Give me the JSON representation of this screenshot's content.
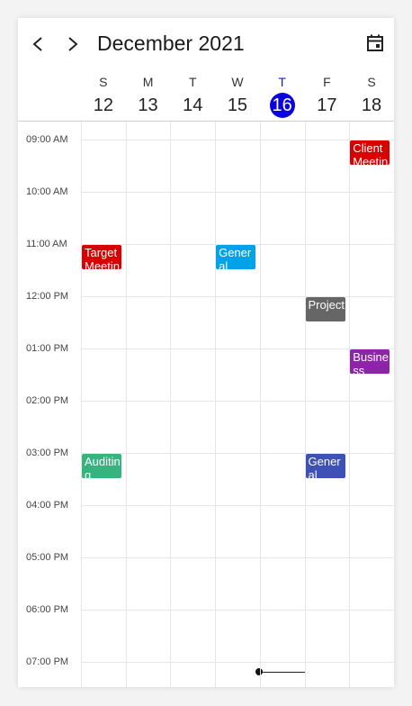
{
  "header": {
    "title": "December 2021",
    "prev_icon": "chevron-left-icon",
    "next_icon": "chevron-right-icon",
    "today_icon": "calendar-icon"
  },
  "days": [
    {
      "label": "S",
      "date": "12"
    },
    {
      "label": "M",
      "date": "13"
    },
    {
      "label": "T",
      "date": "14"
    },
    {
      "label": "W",
      "date": "15"
    },
    {
      "label": "T",
      "date": "16"
    },
    {
      "label": "F",
      "date": "17"
    },
    {
      "label": "S",
      "date": "18"
    }
  ],
  "today_index": 4,
  "today_color": "#0b00e0",
  "times": [
    "09:00 AM",
    "10:00 AM",
    "11:00 AM",
    "12:00 PM",
    "01:00 PM",
    "02:00 PM",
    "03:00 PM",
    "04:00 PM",
    "05:00 PM",
    "06:00 PM",
    "07:00 PM"
  ],
  "appointments": [
    {
      "title": "Client Meeting",
      "day": 6,
      "start": "09:00 AM",
      "color": "#d80000"
    },
    {
      "title": "Target Meeting",
      "day": 0,
      "start": "11:00 AM",
      "color": "#d80000"
    },
    {
      "title": "General",
      "day": 3,
      "start": "11:00 AM",
      "color": "#00a2e8"
    },
    {
      "title": "Project",
      "day": 5,
      "start": "12:00 PM",
      "color": "#666666"
    },
    {
      "title": "Business",
      "day": 6,
      "start": "01:00 PM",
      "color": "#8e24aa"
    },
    {
      "title": "Auditing",
      "day": 0,
      "start": "03:00 PM",
      "color": "#36b37e"
    },
    {
      "title": "General",
      "day": 5,
      "start": "03:00 PM",
      "color": "#3f51b5"
    }
  ]
}
